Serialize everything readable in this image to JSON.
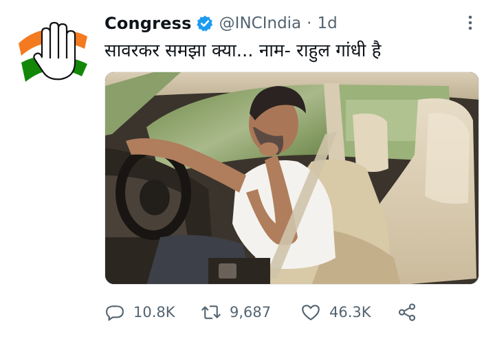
{
  "author": {
    "name": "Congress",
    "handle": "@INCIndia",
    "separator": "·",
    "time": "1d"
  },
  "tweet": {
    "text": "सावरकर समझा क्या... नाम- राहुल गांधी है"
  },
  "actions": {
    "replies": "10.8K",
    "retweets": "9,687",
    "likes": "46.3K"
  },
  "colors": {
    "verified": "#1d9bf0",
    "muted": "#536471",
    "text": "#0f1419",
    "saffron": "#f47a20",
    "green": "#138808"
  },
  "icons": [
    "congress-hand-logo",
    "verified-badge-icon",
    "more-icon",
    "reply-icon",
    "retweet-icon",
    "like-icon",
    "share-icon"
  ]
}
